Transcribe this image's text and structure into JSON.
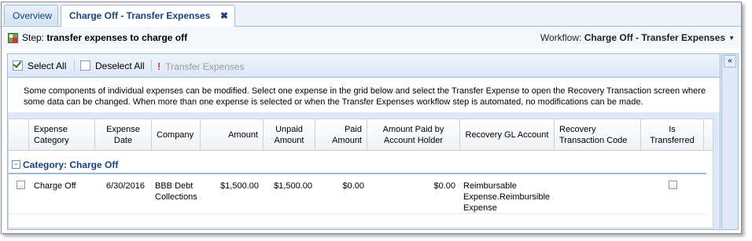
{
  "tabs": [
    {
      "label": "Overview"
    },
    {
      "label": "Charge Off - Transfer Expenses",
      "close": "✖"
    }
  ],
  "step": {
    "prefix": "Step:",
    "name": "transfer expenses to charge off"
  },
  "workflow": {
    "prefix": "Workflow:",
    "name": "Charge Off - Transfer Expenses"
  },
  "toolbar": {
    "select_all": "Select All",
    "deselect_all": "Deselect All",
    "transfer": "Transfer Expenses"
  },
  "info_text": "Some components of individual expenses can be modified. Select one expense in the grid below and select the Transfer Expense to open the Recovery Transaction screen where some data can be changed. When more than one expense is selected or when the Transfer Expenses workflow step is automated, no modifications can be made.",
  "grid": {
    "columns": [
      "Expense Category",
      "Expense Date",
      "Company",
      "Amount",
      "Unpaid Amount",
      "Paid Amount",
      "Amount Paid by Account Holder",
      "Recovery GL Account",
      "Recovery Transaction Code",
      "Is Transferred"
    ],
    "group_label": "Category: Charge Off",
    "rows": [
      {
        "category": "Charge Off",
        "date": "6/30/2016",
        "company": "BBB Debt Collections",
        "amount": "$1,500.00",
        "unpaid": "$1,500.00",
        "paid": "$0.00",
        "paid_by_holder": "$0.00",
        "gl_account": "Reimbursable Expense.Reimbursible Expense",
        "transaction_code": "",
        "is_transferred": false
      }
    ]
  },
  "icons": {
    "collapse": "«",
    "group_toggle": "−"
  }
}
